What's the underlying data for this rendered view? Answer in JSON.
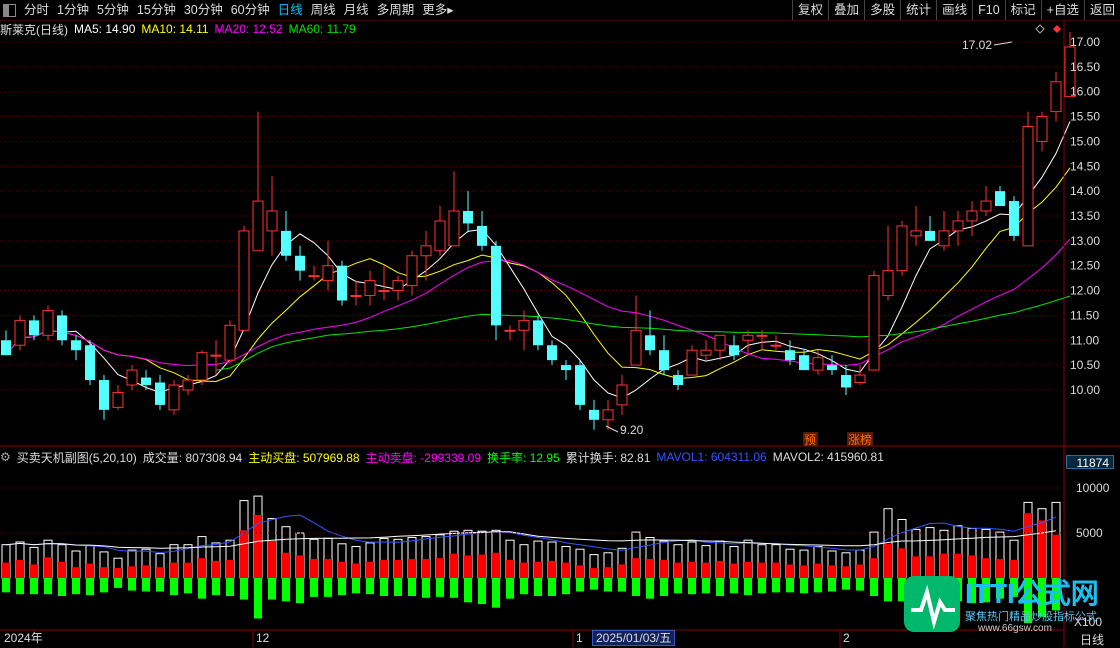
{
  "toolbar": {
    "periods": [
      "分时",
      "1分钟",
      "5分钟",
      "15分钟",
      "30分钟",
      "60分钟",
      "日线",
      "周线",
      "月线",
      "多周期",
      "更多"
    ],
    "active": "日线",
    "more_arrow": "▸",
    "right": [
      "复权",
      "叠加",
      "多股",
      "统计",
      "画线",
      "F10",
      "标记",
      "+自选",
      "返回"
    ]
  },
  "main_header": {
    "title": "斯莱克(日线)",
    "ma5": "MA5: 14.90",
    "ma10": "MA10: 14.11",
    "ma20": "MA20: 12.52",
    "ma60": "MA60: 11.79"
  },
  "sub_header": {
    "title": "买卖天机副图(5,20,10)",
    "vol": "成交量: 807308.94",
    "buy": "主动买盘: 507969.88",
    "sell": "主动卖盘: -299339.09",
    "turnover": "换手率: 12.95",
    "cum_turnover": "累计换手: 82.81",
    "mavol1": "MAVOL1: 604311.06",
    "mavol2": "MAVOL2: 415960.81"
  },
  "price_axis": [
    "17.00",
    "16.50",
    "16.00",
    "15.50",
    "15.00",
    "14.50",
    "14.00",
    "13.50",
    "13.00",
    "12.50",
    "12.00",
    "11.50",
    "11.00",
    "10.50",
    "10.00"
  ],
  "vol_axis": [
    "10000",
    "5000"
  ],
  "vol_axis_box": "11874",
  "vol_unit": "X100",
  "date_labels": {
    "y2024": "2024年",
    "m12": "12",
    "m1": "1",
    "selected_date": "2025/01/03/五",
    "m2": "2"
  },
  "period_label": "日线",
  "markers": {
    "high": "17.02",
    "low": "9.20",
    "pre": "预",
    "limit": "涨榜"
  },
  "watermark": {
    "brand": "ITTI公式网",
    "slogan": "聚焦热门精品炒股指标公式",
    "url": "www.66gsw.com"
  },
  "colors": {
    "up": "#ff3232",
    "down": "#54ffff",
    "ma5": "#ffffff",
    "ma10": "#ffff00",
    "ma20": "#ff00ff",
    "ma60": "#00e600",
    "buy": "#ff0000",
    "sell": "#00ff00"
  },
  "chart_data": {
    "type": "candlestick",
    "ylim": [
      9.6,
      17.3
    ],
    "candles": [
      [
        11.0,
        11.2,
        10.7,
        10.7
      ],
      [
        10.9,
        11.5,
        10.8,
        11.4
      ],
      [
        11.4,
        11.5,
        11.0,
        11.1
      ],
      [
        11.1,
        11.7,
        11.0,
        11.6
      ],
      [
        11.5,
        11.6,
        10.9,
        11.0
      ],
      [
        11.0,
        11.1,
        10.6,
        10.8
      ],
      [
        10.9,
        11.0,
        10.1,
        10.2
      ],
      [
        10.2,
        10.3,
        9.4,
        9.6
      ],
      [
        9.65,
        10.1,
        9.6,
        9.95
      ],
      [
        10.1,
        10.5,
        10.0,
        10.4
      ],
      [
        10.25,
        10.4,
        10.0,
        10.1
      ],
      [
        10.15,
        10.3,
        9.6,
        9.7
      ],
      [
        9.6,
        10.2,
        9.5,
        10.1
      ],
      [
        10.0,
        10.3,
        9.9,
        10.2
      ],
      [
        10.2,
        10.8,
        10.1,
        10.75
      ],
      [
        10.7,
        11.0,
        10.3,
        10.7
      ],
      [
        10.6,
        11.4,
        10.6,
        11.3
      ],
      [
        11.2,
        13.3,
        11.2,
        13.2
      ],
      [
        12.8,
        15.6,
        12.8,
        13.8
      ],
      [
        13.2,
        14.3,
        12.7,
        13.6
      ],
      [
        13.2,
        13.6,
        12.6,
        12.7
      ],
      [
        12.7,
        12.9,
        12.2,
        12.4
      ],
      [
        12.3,
        12.5,
        12.2,
        12.3
      ],
      [
        12.2,
        13.0,
        12.0,
        12.5
      ],
      [
        12.5,
        12.6,
        11.7,
        11.8
      ],
      [
        11.9,
        12.2,
        11.7,
        11.9
      ],
      [
        11.9,
        12.4,
        11.7,
        12.2
      ],
      [
        12.0,
        12.5,
        11.8,
        12.0
      ],
      [
        12.0,
        12.3,
        11.8,
        12.2
      ],
      [
        12.1,
        12.8,
        11.9,
        12.7
      ],
      [
        12.7,
        13.2,
        12.2,
        12.9
      ],
      [
        12.8,
        13.7,
        12.7,
        13.4
      ],
      [
        12.9,
        14.4,
        12.9,
        13.6
      ],
      [
        13.6,
        14.0,
        13.2,
        13.35
      ],
      [
        13.3,
        13.6,
        12.8,
        12.9
      ],
      [
        12.9,
        13.0,
        11.0,
        11.3
      ],
      [
        11.2,
        11.3,
        11.0,
        11.2
      ],
      [
        11.2,
        11.6,
        10.8,
        11.4
      ],
      [
        11.4,
        11.5,
        10.8,
        10.9
      ],
      [
        10.9,
        11.0,
        10.5,
        10.6
      ],
      [
        10.5,
        10.6,
        10.2,
        10.4
      ],
      [
        10.5,
        10.6,
        9.6,
        9.7
      ],
      [
        9.6,
        9.8,
        9.2,
        9.4
      ],
      [
        9.4,
        9.8,
        9.2,
        9.6
      ],
      [
        9.7,
        10.3,
        9.5,
        10.1
      ],
      [
        10.5,
        11.9,
        10.5,
        11.2
      ],
      [
        11.1,
        11.6,
        10.7,
        10.8
      ],
      [
        10.8,
        11.1,
        10.3,
        10.4
      ],
      [
        10.3,
        10.4,
        10.0,
        10.1
      ],
      [
        10.3,
        10.9,
        10.3,
        10.8
      ],
      [
        10.7,
        11.0,
        10.6,
        10.8
      ],
      [
        10.8,
        11.1,
        10.6,
        11.1
      ],
      [
        10.9,
        11.1,
        10.6,
        10.7
      ],
      [
        11.0,
        11.2,
        10.7,
        11.1
      ],
      [
        11.1,
        11.2,
        10.8,
        11.1
      ],
      [
        10.9,
        11.1,
        10.8,
        10.9
      ],
      [
        10.8,
        11.0,
        10.5,
        10.6
      ],
      [
        10.7,
        10.8,
        10.4,
        10.4
      ],
      [
        10.4,
        10.8,
        10.3,
        10.65
      ],
      [
        10.5,
        10.7,
        10.3,
        10.4
      ],
      [
        10.3,
        10.5,
        9.9,
        10.05
      ],
      [
        10.15,
        10.5,
        10.1,
        10.3
      ],
      [
        10.4,
        12.4,
        10.4,
        12.3
      ],
      [
        11.9,
        13.3,
        11.8,
        12.4
      ],
      [
        12.4,
        13.4,
        12.3,
        13.3
      ],
      [
        13.1,
        13.7,
        12.9,
        13.2
      ],
      [
        13.2,
        13.5,
        13.0,
        13.0
      ],
      [
        12.9,
        13.6,
        12.8,
        13.2
      ],
      [
        13.2,
        13.6,
        12.9,
        13.4
      ],
      [
        13.4,
        13.8,
        13.1,
        13.6
      ],
      [
        13.6,
        14.1,
        13.5,
        13.8
      ],
      [
        14.0,
        14.1,
        13.7,
        13.7
      ],
      [
        13.8,
        13.9,
        13.0,
        13.1
      ],
      [
        12.9,
        15.6,
        12.9,
        15.3
      ],
      [
        15.0,
        15.6,
        14.8,
        15.5
      ],
      [
        15.6,
        16.4,
        15.4,
        16.2
      ],
      [
        15.9,
        17.2,
        15.9,
        16.9
      ]
    ],
    "volume": [
      3700,
      4000,
      3400,
      4200,
      3700,
      3000,
      3600,
      2900,
      2200,
      3100,
      3200,
      2700,
      3700,
      3700,
      4600,
      3900,
      4200,
      8600,
      9100,
      6600,
      5700,
      5000,
      4300,
      4400,
      3800,
      3500,
      3900,
      4400,
      4300,
      4500,
      4600,
      4800,
      5200,
      5300,
      5200,
      5300,
      4200,
      3700,
      4100,
      4000,
      3500,
      3200,
      2600,
      2800,
      3300,
      5100,
      4500,
      4100,
      3700,
      4000,
      3600,
      4100,
      3500,
      4200,
      3700,
      3700,
      3200,
      3100,
      3500,
      3000,
      2800,
      3100,
      5100,
      7700,
      6500,
      5400,
      5600,
      5300,
      5800,
      5500,
      5400,
      5100,
      4200,
      8400,
      7700,
      8400
    ],
    "buy": [
      1700,
      2000,
      1500,
      2300,
      1800,
      1200,
      1600,
      1200,
      1100,
      1300,
      1400,
      1200,
      1700,
      1700,
      2200,
      1900,
      2000,
      5300,
      7000,
      4100,
      2800,
      2500,
      2100,
      2100,
      1800,
      1600,
      1800,
      2000,
      2000,
      2100,
      2100,
      2200,
      2700,
      2500,
      2600,
      2800,
      2000,
      1700,
      1800,
      1900,
      1700,
      1400,
      1100,
      1200,
      1500,
      2200,
      2100,
      2000,
      1700,
      1800,
      1700,
      1900,
      1600,
      1800,
      1700,
      1700,
      1500,
      1400,
      1600,
      1400,
      1300,
      1500,
      2200,
      3800,
      3300,
      2400,
      2400,
      2700,
      2700,
      2500,
      2200,
      2100,
      2000,
      7200,
      6400,
      4800
    ],
    "sell": [
      1600,
      1800,
      1800,
      1800,
      2000,
      1800,
      1900,
      1600,
      1100,
      1400,
      1500,
      1500,
      1900,
      1700,
      2300,
      1900,
      2000,
      2400,
      4500,
      2400,
      2600,
      2800,
      2100,
      2100,
      1900,
      1700,
      1800,
      2000,
      2000,
      2000,
      2200,
      2100,
      2200,
      2700,
      2900,
      3300,
      2300,
      1800,
      2000,
      2000,
      1800,
      1500,
      1300,
      1500,
      1500,
      2000,
      2300,
      2000,
      1700,
      1800,
      1700,
      2000,
      1700,
      1900,
      1700,
      1600,
      1600,
      1700,
      1600,
      1500,
      1300,
      1400,
      2000,
      2600,
      2600,
      2400,
      2600,
      2600,
      2600,
      2800,
      2700,
      2300,
      2100,
      5000,
      4300,
      3600
    ]
  }
}
